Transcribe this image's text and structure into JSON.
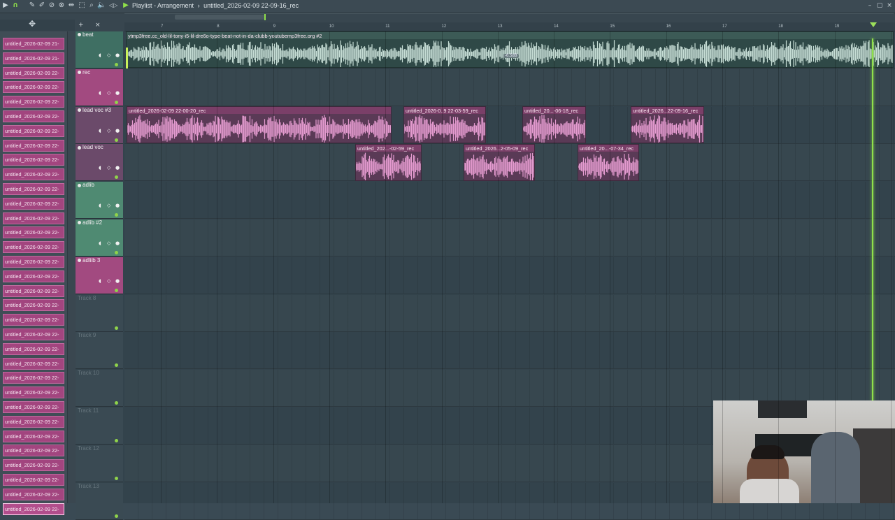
{
  "window": {
    "breadcrumb": "Playlist - Arrangement",
    "separator": "›",
    "pattern": "untitled_2026-02-09 22-09-16_rec"
  },
  "ruler": {
    "bars": [
      "7",
      "8",
      "9",
      "10",
      "11",
      "12",
      "13",
      "14",
      "15",
      "16",
      "17",
      "18",
      "19"
    ]
  },
  "picker": {
    "items": [
      "untitled_2026-02-09 21-",
      "untitled_2026-02-09 21-",
      "untitled_2026-02-09 22-",
      "untitled_2026-02-09 22-",
      "untitled_2026-02-09 22-",
      "untitled_2026-02-09 22-",
      "untitled_2026-02-09 22-",
      "untitled_2026-02-09 22-",
      "untitled_2026-02-09 22-",
      "untitled_2026-02-09 22-",
      "untitled_2026-02-09 22-",
      "untitled_2026-02-09 22-",
      "untitled_2026-02-09 22-",
      "untitled_2026-02-09 22-",
      "untitled_2026-02-09 22-",
      "untitled_2026-02-09 22-",
      "untitled_2026-02-09 22-",
      "untitled_2026-02-09 22-",
      "untitled_2026-02-09 22-",
      "untitled_2026-02-09 22-",
      "untitled_2026-02-09 22-",
      "untitled_2026-02-09 22-",
      "untitled_2026-02-09 22-",
      "untitled_2026-02-09 22-",
      "untitled_2026-02-09 22-",
      "untitled_2026-02-09 22-",
      "untitled_2026-02-09 22-",
      "untitled_2026-02-09 22-",
      "untitled_2026-02-09 22-",
      "untitled_2026-02-09 22-",
      "untitled_2026-02-09 22-",
      "untitled_2026-02-09 22-",
      "untitled_2026-02-09 22-"
    ]
  },
  "tracks": [
    {
      "name": "beat",
      "color": "#3f6f63"
    },
    {
      "name": "rec",
      "color": "#a24a80"
    },
    {
      "name": "lead voc #3",
      "color": "#6b4a6a"
    },
    {
      "name": "lead voc",
      "color": "#6b4a6a"
    },
    {
      "name": "adlib",
      "color": "#4f8a72"
    },
    {
      "name": "adlib #2",
      "color": "#4f8a72"
    },
    {
      "name": "adliib 3",
      "color": "#a24a80"
    },
    {
      "name": "Track 8",
      "color": ""
    },
    {
      "name": "Track 9",
      "color": ""
    },
    {
      "name": "Track 10",
      "color": ""
    },
    {
      "name": "Track 11",
      "color": ""
    },
    {
      "name": "Track 12",
      "color": ""
    },
    {
      "name": "Track 13",
      "color": ""
    }
  ],
  "clips": {
    "beat": {
      "name": "ytmp3free.cc_old-lil-tony-i5-lil-dre6o-type-beat-not-in-da-clubb-youtubemp3free.org #2",
      "gain": "-6.5dB"
    },
    "leadvoc3": [
      "untitled_2026-02-09 22-00-20_rec",
      "untitled_2026-0..9 22-03-59_rec",
      "untitled_20...-06-18_rec",
      "untitled_2026...22-09-16_rec"
    ],
    "leadvoc": [
      "untitled_202...-02-59_rec",
      "untitled_2026...2-05-09_rec",
      "untitled_20...-07-34_rec"
    ]
  },
  "icons": {
    "play": "▶",
    "magnet": "∩",
    "pencil": "✎",
    "brush": "✐",
    "delete": "⊘",
    "mute": "⊗",
    "slice": "⇹",
    "select": "⬚",
    "zoom": "⌕",
    "speaker": "🔈",
    "pattern": "◁▷",
    "minimize": "–",
    "maximize": "▢",
    "close": "×",
    "add": "+"
  },
  "colors": {
    "accent_green": "#8fe04a",
    "clip_pink": "#d68bbd",
    "audio_waveform_beat": "#c6ddd5"
  }
}
